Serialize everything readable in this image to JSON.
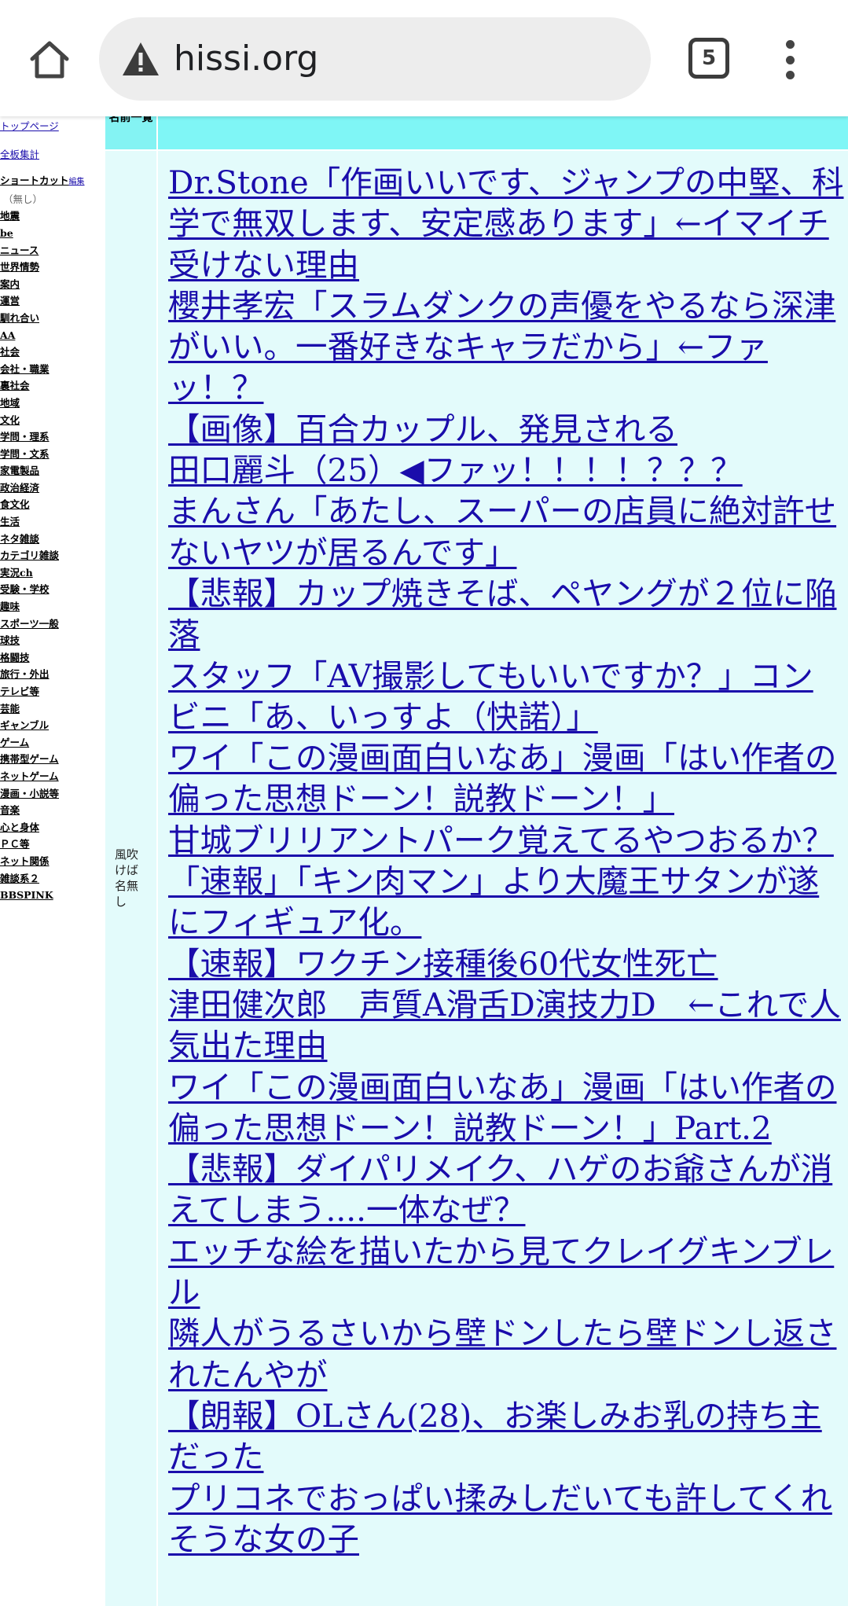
{
  "browser": {
    "url": "hissi.org",
    "tab_count": "5"
  },
  "sidebar": {
    "top_link": "トップページ",
    "stats_link": "全板集計",
    "shortcut_label": "ショートカット",
    "shortcut_edit": "編集",
    "shortcut_none": "（無し）",
    "categories": [
      "地震",
      "be",
      "ニュース",
      "世界情勢",
      "案内",
      "運営",
      "馴れ合い",
      "AA",
      "社会",
      "会社・職業",
      "裏社会",
      "地域",
      "文化",
      "学問・理系",
      "学問・文系",
      "家電製品",
      "政治経済",
      "食文化",
      "生活",
      "ネタ雑談",
      "カテゴリ雑談",
      "実況ch",
      "受験・学校",
      "趣味",
      "スポーツ一般",
      "球技",
      "格闘技",
      "旅行・外出",
      "テレビ等",
      "芸能",
      "ギャンブル",
      "ゲーム",
      "携帯型ゲーム",
      "ネットゲーム",
      "漫画・小説等",
      "音楽",
      "心と身体",
      "ＰＣ等",
      "ネット関係",
      "雑談系２",
      "BBSPINK"
    ]
  },
  "table": {
    "header_name": "名前一覧",
    "row_name": "風吹けば名無し",
    "threads": [
      "Dr.Stone「作画いいです、ジャンプの中堅、科学で無双します、安定感あります」←イマイチ受けない理由",
      "櫻井孝宏「スラムダンクの声優をやるなら深津がいい。一番好きなキャラだから」←ファッ！？",
      "【画像】百合カップル、発見される",
      "田口麗斗（25）◀ファッ！！！！？？？",
      "まんさん「あたし、スーパーの店員に絶対許せないヤツが居るんです」",
      "【悲報】カップ焼きそば、ペヤングが２位に陥落",
      "スタッフ「AV撮影してもいいですか？」コンビニ「あ、いっすよ（快諾）」",
      "ワイ「この漫画面白いなあ」漫画「はい作者の偏った思想ドーン！説教ドーン！」",
      "甘城ブリリアントパーク覚えてるやつおるか？",
      "「速報」「キン肉マン」より大魔王サタンが遂にフィギュア化。",
      "【速報】ワクチン接種後60代女性死亡",
      "津田健次郎　声質A滑舌D演技力D　←これで人気出た理由",
      "ワイ「この漫画面白いなあ」漫画「はい作者の偏った思想ドーン！説教ドーン！」Part.2",
      "【悲報】ダイパリメイク、ハゲのお爺さんが消えてしまう....一体なぜ？",
      "エッチな絵を描いたから見てクレイグキンブレル",
      "隣人がうるさいから壁ドンしたら壁ドンし返されたんやが",
      "【朗報】OLさん(28)、お楽しみお乳の持ち主だった",
      "プリコネでおっぱい揉みしだいても許してくれそうな女の子"
    ]
  }
}
